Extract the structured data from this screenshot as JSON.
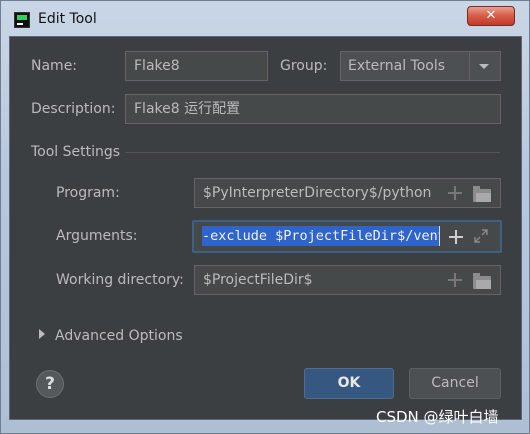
{
  "window": {
    "title": "Edit Tool",
    "close_symbol": "✕"
  },
  "form": {
    "name_label": "Name:",
    "name_value": "Flake8",
    "group_label": "Group:",
    "group_value": "External Tools",
    "description_label": "Description:",
    "description_value": "Flake8 运行配置"
  },
  "tool_settings": {
    "section_title": "Tool Settings",
    "program_label": "Program:",
    "program_value": "$PyInterpreterDirectory$/python",
    "arguments_label": "Arguments:",
    "arguments_value": "-exclude $ProjectFileDir$/venv",
    "working_dir_label": "Working directory:",
    "working_dir_value": "$ProjectFileDir$"
  },
  "advanced": {
    "label": "Advanced Options"
  },
  "buttons": {
    "help": "?",
    "ok": "OK",
    "cancel": "Cancel"
  },
  "watermark": "CSDN @绿叶白墙",
  "colors": {
    "panel_bg": "#3c3f41",
    "field_bg": "#45494a",
    "selection": "#2f65ca",
    "ok_button": "#365880",
    "close_button": "#c0392b"
  }
}
